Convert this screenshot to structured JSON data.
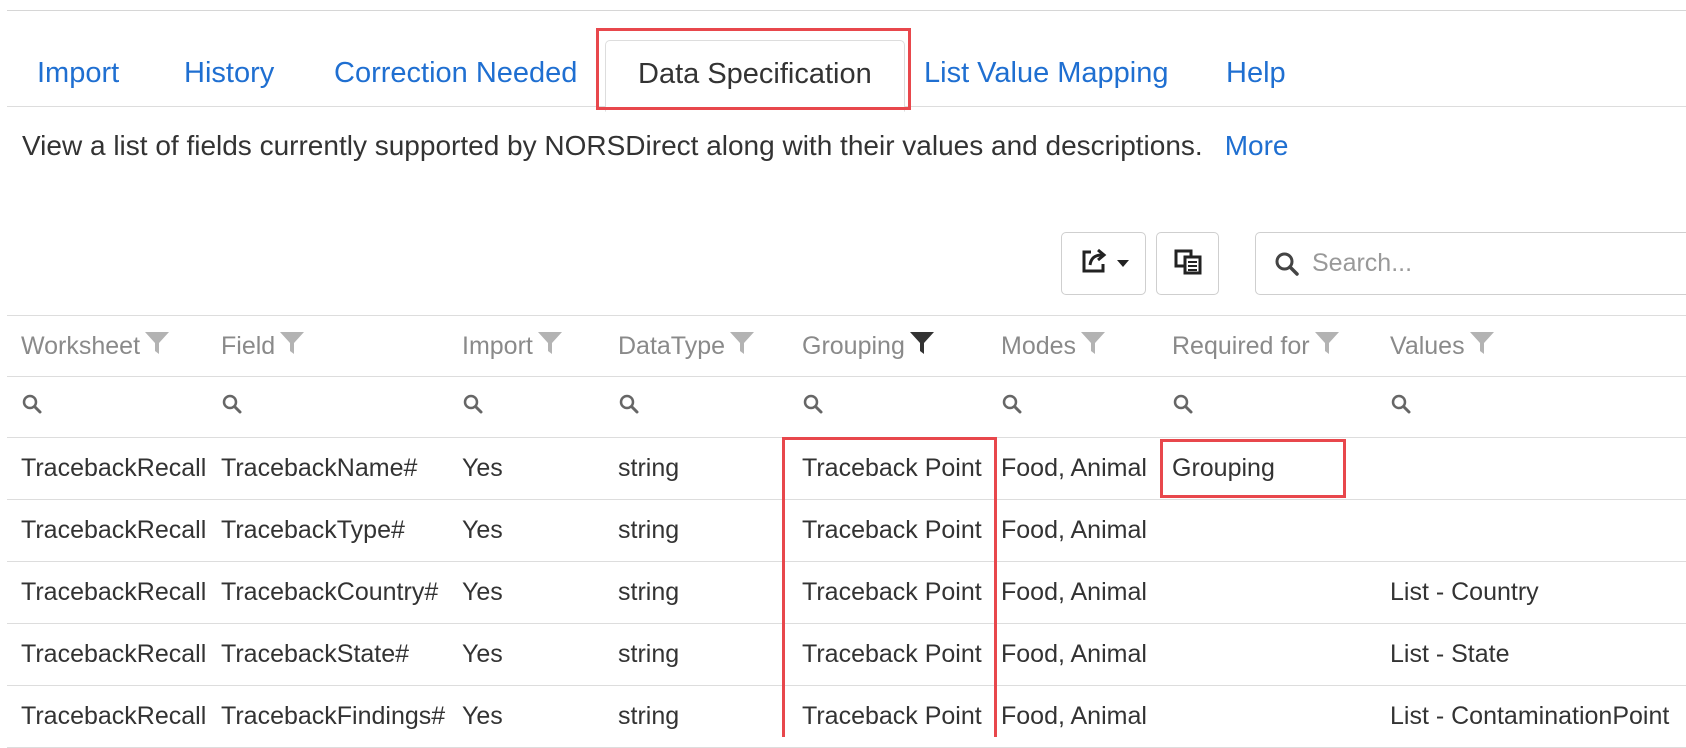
{
  "tabs": [
    {
      "label": "Import"
    },
    {
      "label": "History"
    },
    {
      "label": "Correction Needed"
    },
    {
      "label": "Data Specification",
      "active": true
    },
    {
      "label": "List Value Mapping"
    },
    {
      "label": "Help"
    }
  ],
  "intro": {
    "text": "View a list of fields currently supported by NORSDirect along with their values and descriptions.",
    "more_link": "More"
  },
  "toolbar": {
    "export_icon": "export-icon",
    "columns_icon": "column-chooser-icon",
    "search_placeholder": "Search..."
  },
  "colors": {
    "link": "#1f6fd1",
    "highlight": "#e8474c",
    "border": "#dddddd"
  },
  "grid": {
    "columns": [
      "Worksheet",
      "Field",
      "Import",
      "DataType",
      "Grouping",
      "Modes",
      "Required for",
      "Values"
    ],
    "rows": [
      [
        "TracebackRecall",
        "TracebackName#",
        "Yes",
        "string",
        "Traceback Point",
        "Food, Animal",
        "Grouping",
        ""
      ],
      [
        "TracebackRecall",
        "TracebackType#",
        "Yes",
        "string",
        "Traceback Point",
        "Food, Animal",
        "",
        ""
      ],
      [
        "TracebackRecall",
        "TracebackCountry#",
        "Yes",
        "string",
        "Traceback Point",
        "Food, Animal",
        "",
        "List - Country"
      ],
      [
        "TracebackRecall",
        "TracebackState#",
        "Yes",
        "string",
        "Traceback Point",
        "Food, Animal",
        "",
        "List - State"
      ],
      [
        "TracebackRecall",
        "TracebackFindings#",
        "Yes",
        "string",
        "Traceback Point",
        "Food, Animal",
        "",
        "List - ContaminationPoint"
      ]
    ]
  }
}
